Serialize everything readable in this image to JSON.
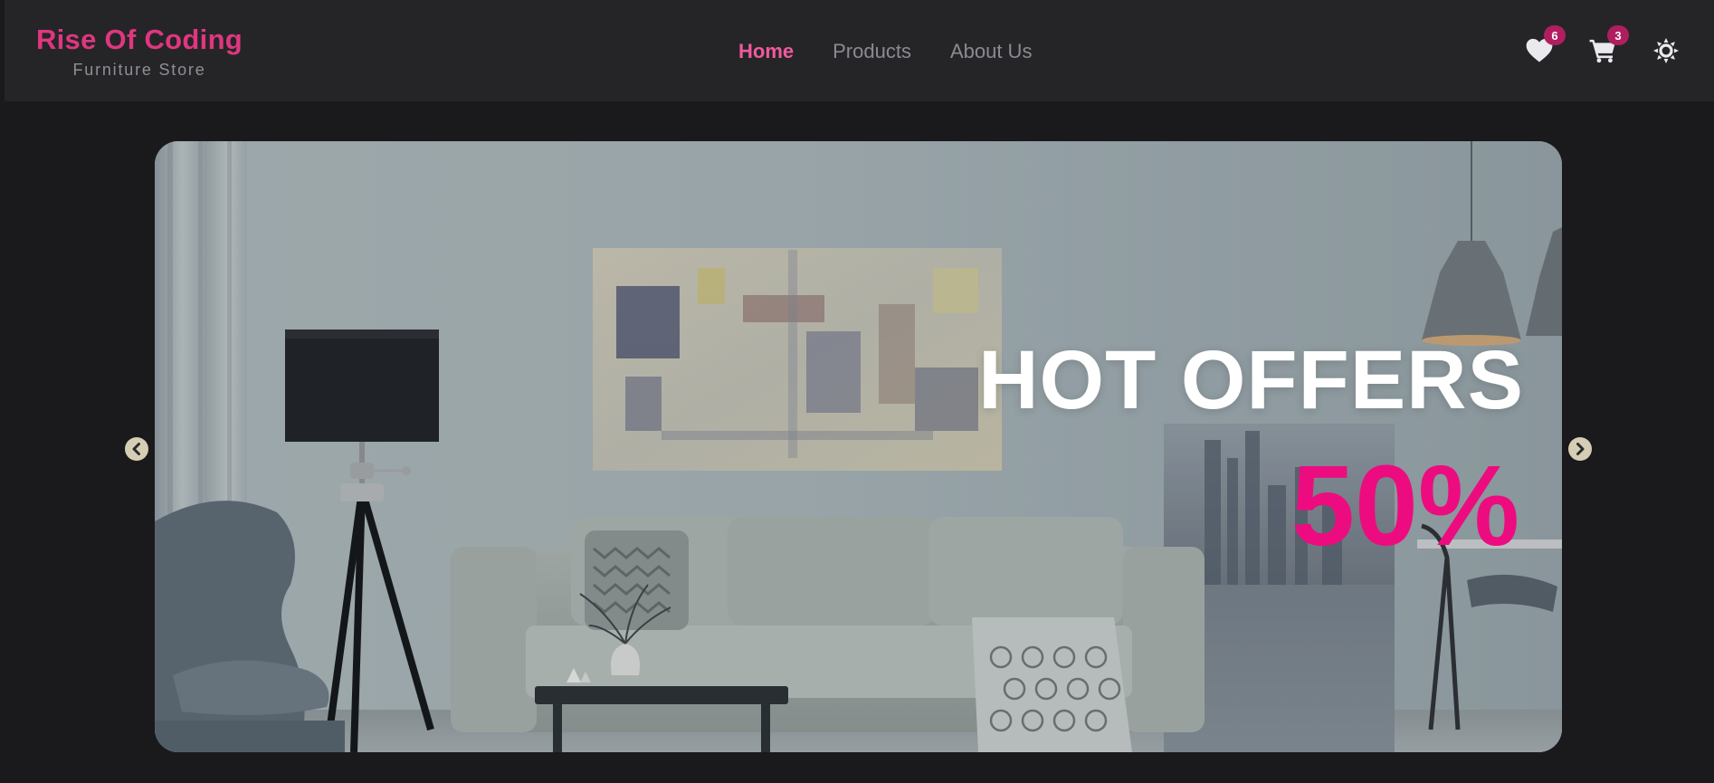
{
  "brand": {
    "title": "Rise Of Coding",
    "subtitle": "Furniture Store"
  },
  "nav": {
    "links": [
      {
        "label": "Home",
        "active": true
      },
      {
        "label": "Products",
        "active": false
      },
      {
        "label": "About Us",
        "active": false
      }
    ]
  },
  "header_actions": {
    "wishlist_count": "6",
    "cart_count": "3",
    "icons": [
      "heart-icon",
      "cart-icon",
      "sun-icon"
    ]
  },
  "hero": {
    "title": "HOT OFFERS",
    "discount": "50%",
    "prev_icon": "chevron-left-icon",
    "next_icon": "chevron-right-icon"
  },
  "colors": {
    "accent": "#e0367f",
    "discount": "#ec0c80",
    "badge": "#b01e60",
    "nav_bg": "#252528",
    "page_bg": "#1a1a1d"
  }
}
